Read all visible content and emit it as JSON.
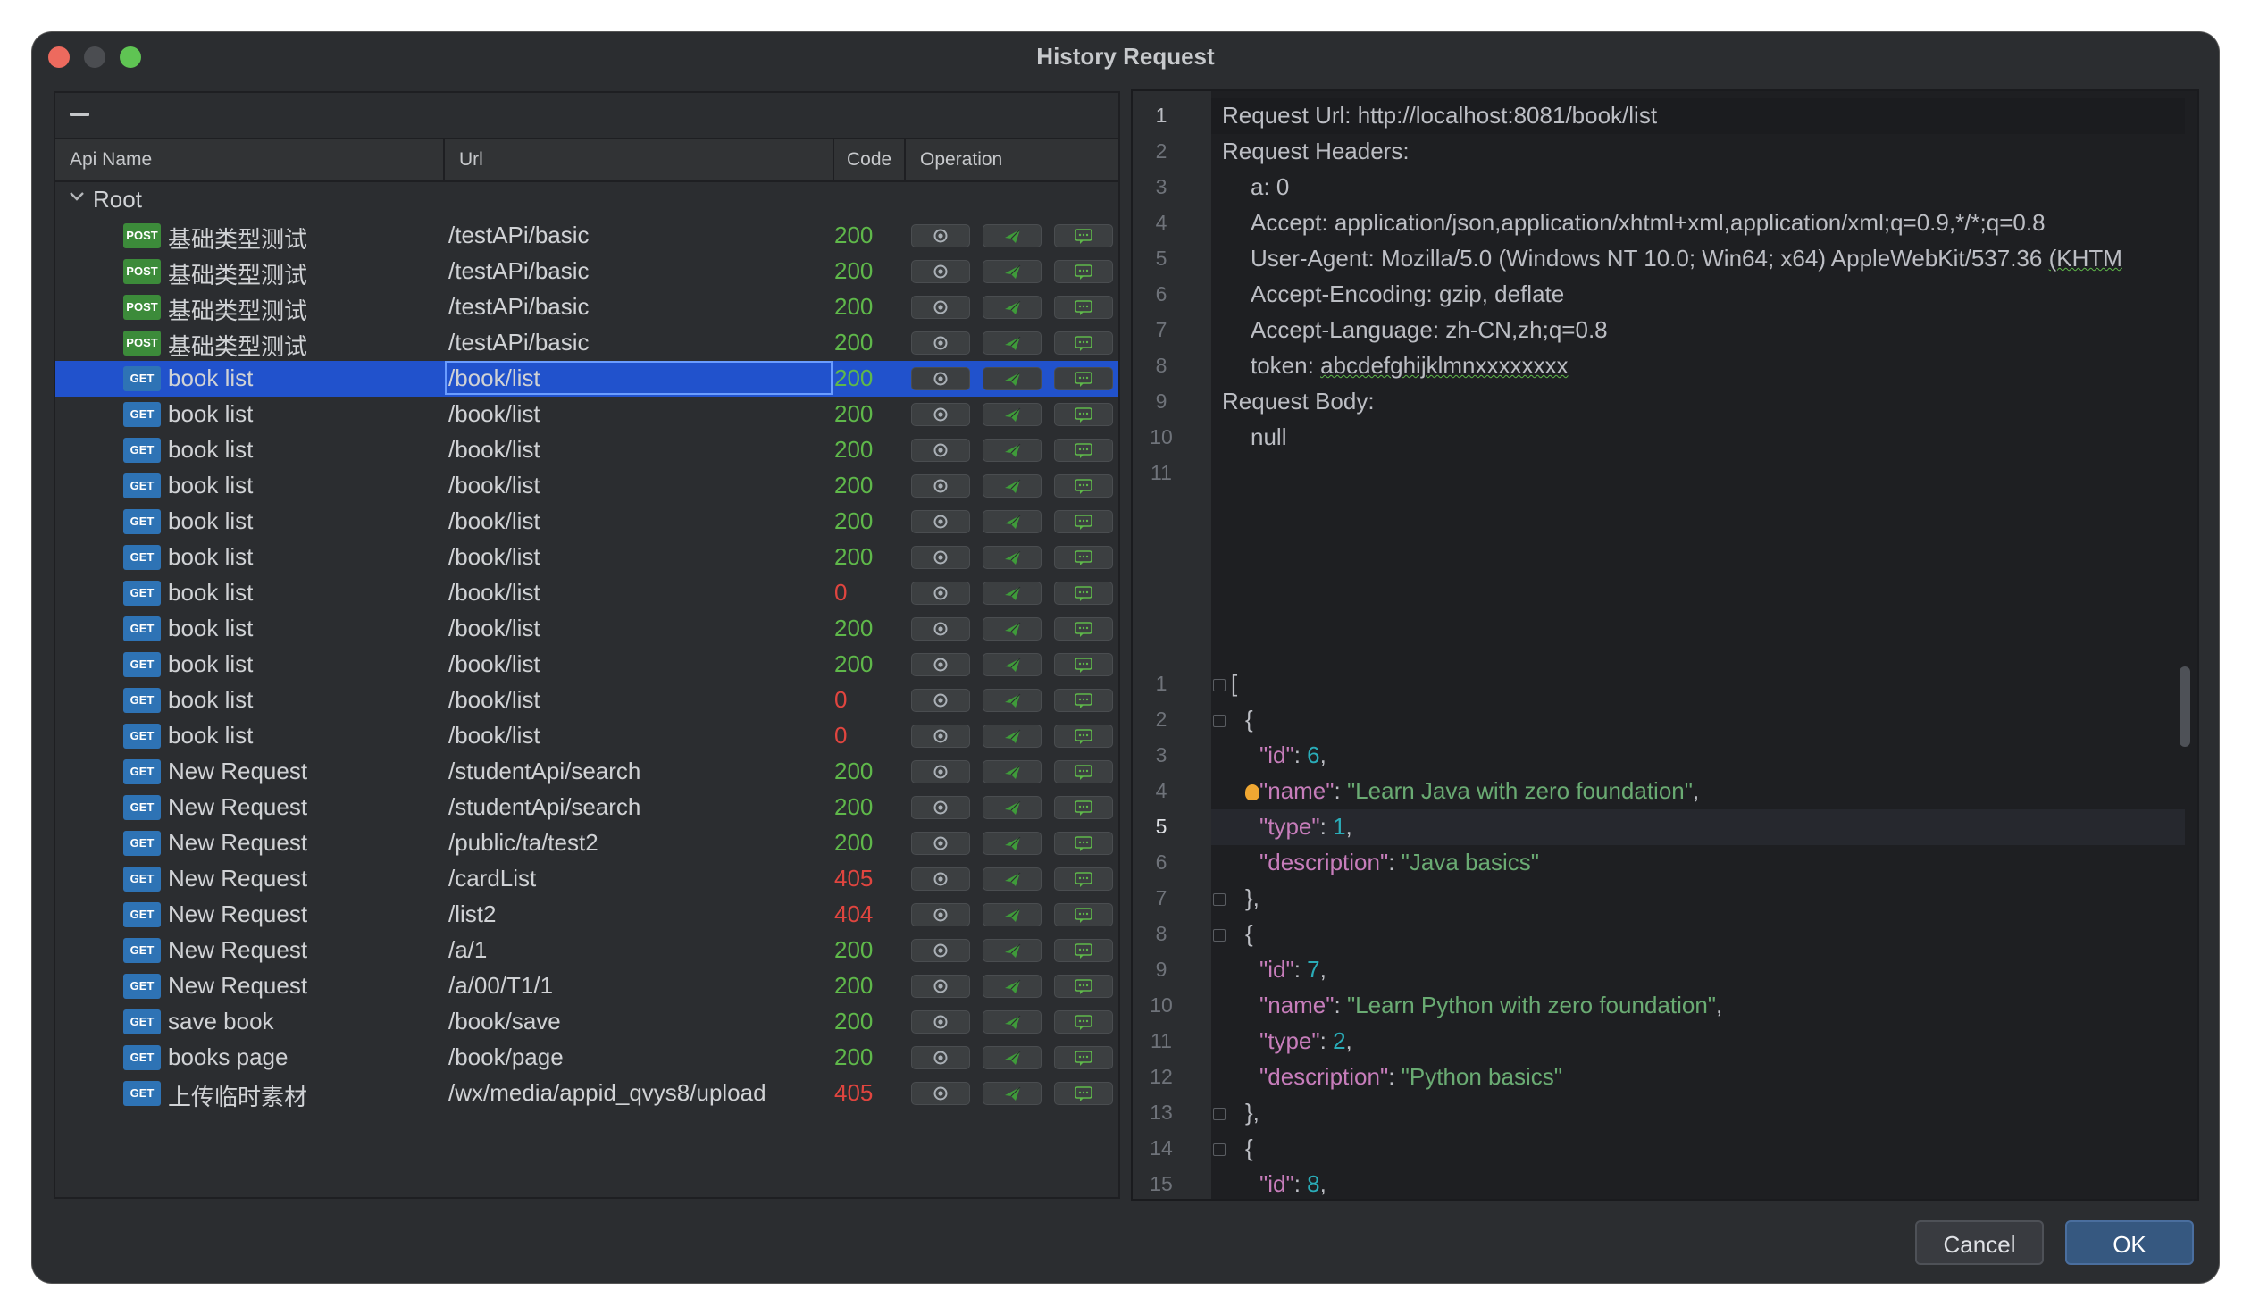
{
  "window": {
    "title": "History Request"
  },
  "table": {
    "headers": {
      "api_name": "Api Name",
      "url": "Url",
      "code": "Code",
      "operation": "Operation"
    },
    "root_label": "Root",
    "rows": [
      {
        "method": "POST",
        "name": "基础类型测试",
        "url": "/testAPi/basic",
        "code": "200",
        "ok": true
      },
      {
        "method": "POST",
        "name": "基础类型测试",
        "url": "/testAPi/basic",
        "code": "200",
        "ok": true
      },
      {
        "method": "POST",
        "name": "基础类型测试",
        "url": "/testAPi/basic",
        "code": "200",
        "ok": true
      },
      {
        "method": "POST",
        "name": "基础类型测试",
        "url": "/testAPi/basic",
        "code": "200",
        "ok": true
      },
      {
        "method": "GET",
        "name": "book list",
        "url": "/book/list",
        "code": "200",
        "ok": true,
        "selected": true
      },
      {
        "method": "GET",
        "name": "book list",
        "url": "/book/list",
        "code": "200",
        "ok": true
      },
      {
        "method": "GET",
        "name": "book list",
        "url": "/book/list",
        "code": "200",
        "ok": true
      },
      {
        "method": "GET",
        "name": "book list",
        "url": "/book/list",
        "code": "200",
        "ok": true
      },
      {
        "method": "GET",
        "name": "book list",
        "url": "/book/list",
        "code": "200",
        "ok": true
      },
      {
        "method": "GET",
        "name": "book list",
        "url": "/book/list",
        "code": "200",
        "ok": true
      },
      {
        "method": "GET",
        "name": "book list",
        "url": "/book/list",
        "code": "0",
        "ok": false
      },
      {
        "method": "GET",
        "name": "book list",
        "url": "/book/list",
        "code": "200",
        "ok": true
      },
      {
        "method": "GET",
        "name": "book list",
        "url": "/book/list",
        "code": "200",
        "ok": true
      },
      {
        "method": "GET",
        "name": "book list",
        "url": "/book/list",
        "code": "0",
        "ok": false
      },
      {
        "method": "GET",
        "name": "book list",
        "url": "/book/list",
        "code": "0",
        "ok": false
      },
      {
        "method": "GET",
        "name": "New Request",
        "url": "/studentApi/search",
        "code": "200",
        "ok": true
      },
      {
        "method": "GET",
        "name": "New Request",
        "url": "/studentApi/search",
        "code": "200",
        "ok": true
      },
      {
        "method": "GET",
        "name": "New Request",
        "url": "/public/ta/test2",
        "code": "200",
        "ok": true
      },
      {
        "method": "GET",
        "name": "New Request",
        "url": "/cardList",
        "code": "405",
        "ok": false
      },
      {
        "method": "GET",
        "name": "New Request",
        "url": "/list2",
        "code": "404",
        "ok": false
      },
      {
        "method": "GET",
        "name": "New Request",
        "url": "/a/1",
        "code": "200",
        "ok": true
      },
      {
        "method": "GET",
        "name": "New Request",
        "url": "/a/00/T1/1",
        "code": "200",
        "ok": true
      },
      {
        "method": "GET",
        "name": "save book",
        "url": "/book/save",
        "code": "200",
        "ok": true
      },
      {
        "method": "GET",
        "name": "books page",
        "url": "/book/page",
        "code": "200",
        "ok": true
      },
      {
        "method": "GET",
        "name": "上传临时素材",
        "url": "/wx/media/appid_qvys8/upload",
        "code": "405",
        "ok": false
      }
    ],
    "operation_icons": [
      "view-icon",
      "send-icon",
      "comment-icon"
    ]
  },
  "request_editor": {
    "lines": [
      {
        "num": "1",
        "text": "Request Url: http://localhost:8081/book/list",
        "indent": 0
      },
      {
        "num": "2",
        "text": "Request Headers:",
        "indent": 0
      },
      {
        "num": "3",
        "text": "a: 0",
        "indent": 1
      },
      {
        "num": "4",
        "text": "Accept: application/json,application/xhtml+xml,application/xml;q=0.9,*/*;q=0.8",
        "indent": 1
      },
      {
        "num": "5",
        "text": "User-Agent: Mozilla/5.0 (Windows NT 10.0; Win64; x64) AppleWebKit/537.36 (KHTM",
        "indent": 1
      },
      {
        "num": "6",
        "text": "Accept-Encoding: gzip, deflate",
        "indent": 1
      },
      {
        "num": "7",
        "text": "Accept-Language: zh-CN,zh;q=0.8",
        "indent": 1
      },
      {
        "num": "8",
        "text": "token: abcdefghijklmnxxxxxxxx",
        "indent": 1
      },
      {
        "num": "9",
        "text": "Request Body:",
        "indent": 0
      },
      {
        "num": "10",
        "text": "null",
        "indent": 1
      },
      {
        "num": "11",
        "text": "",
        "indent": 0
      }
    ]
  },
  "response_editor": {
    "current_line": "5",
    "lines": [
      {
        "num": "1",
        "parts": [
          {
            "t": "p",
            "v": "["
          }
        ],
        "indent": 0,
        "fold": true
      },
      {
        "num": "2",
        "parts": [
          {
            "t": "p",
            "v": "{"
          }
        ],
        "indent": 1,
        "fold": true
      },
      {
        "num": "3",
        "parts": [
          {
            "t": "k",
            "v": "\"id\""
          },
          {
            "t": "p",
            "v": ": "
          },
          {
            "t": "n",
            "v": "6"
          },
          {
            "t": "p",
            "v": ","
          }
        ],
        "indent": 2
      },
      {
        "num": "4",
        "parts": [
          {
            "t": "k",
            "v": "\"name\""
          },
          {
            "t": "p",
            "v": ": "
          },
          {
            "t": "s",
            "v": "\"Learn Java with zero foundation\""
          },
          {
            "t": "p",
            "v": ","
          }
        ],
        "indent": 2,
        "bulb": true
      },
      {
        "num": "5",
        "parts": [
          {
            "t": "k",
            "v": "\"type\""
          },
          {
            "t": "p",
            "v": ": "
          },
          {
            "t": "n",
            "v": "1"
          },
          {
            "t": "p",
            "v": ","
          }
        ],
        "indent": 2
      },
      {
        "num": "6",
        "parts": [
          {
            "t": "k",
            "v": "\"description\""
          },
          {
            "t": "p",
            "v": ": "
          },
          {
            "t": "s",
            "v": "\"Java basics\""
          }
        ],
        "indent": 2
      },
      {
        "num": "7",
        "parts": [
          {
            "t": "p",
            "v": "},"
          }
        ],
        "indent": 1,
        "fold": true
      },
      {
        "num": "8",
        "parts": [
          {
            "t": "p",
            "v": "{"
          }
        ],
        "indent": 1,
        "fold": true
      },
      {
        "num": "9",
        "parts": [
          {
            "t": "k",
            "v": "\"id\""
          },
          {
            "t": "p",
            "v": ": "
          },
          {
            "t": "n",
            "v": "7"
          },
          {
            "t": "p",
            "v": ","
          }
        ],
        "indent": 2
      },
      {
        "num": "10",
        "parts": [
          {
            "t": "k",
            "v": "\"name\""
          },
          {
            "t": "p",
            "v": ": "
          },
          {
            "t": "s",
            "v": "\"Learn Python with zero foundation\""
          },
          {
            "t": "p",
            "v": ","
          }
        ],
        "indent": 2
      },
      {
        "num": "11",
        "parts": [
          {
            "t": "k",
            "v": "\"type\""
          },
          {
            "t": "p",
            "v": ": "
          },
          {
            "t": "n",
            "v": "2"
          },
          {
            "t": "p",
            "v": ","
          }
        ],
        "indent": 2
      },
      {
        "num": "12",
        "parts": [
          {
            "t": "k",
            "v": "\"description\""
          },
          {
            "t": "p",
            "v": ": "
          },
          {
            "t": "s",
            "v": "\"Python basics\""
          }
        ],
        "indent": 2
      },
      {
        "num": "13",
        "parts": [
          {
            "t": "p",
            "v": "},"
          }
        ],
        "indent": 1,
        "fold": true
      },
      {
        "num": "14",
        "parts": [
          {
            "t": "p",
            "v": "{"
          }
        ],
        "indent": 1,
        "fold": true
      },
      {
        "num": "15",
        "parts": [
          {
            "t": "k",
            "v": "\"id\""
          },
          {
            "t": "p",
            "v": ": "
          },
          {
            "t": "n",
            "v": "8"
          },
          {
            "t": "p",
            "v": ","
          }
        ],
        "indent": 2
      }
    ]
  },
  "buttons": {
    "cancel": "Cancel",
    "ok": "OK"
  },
  "colors": {
    "ok_code": "#5fb84a",
    "error_code": "#e0453f",
    "selection": "#2152cc",
    "post_badge": "#3c8b3a",
    "get_badge": "#2e73b5"
  }
}
